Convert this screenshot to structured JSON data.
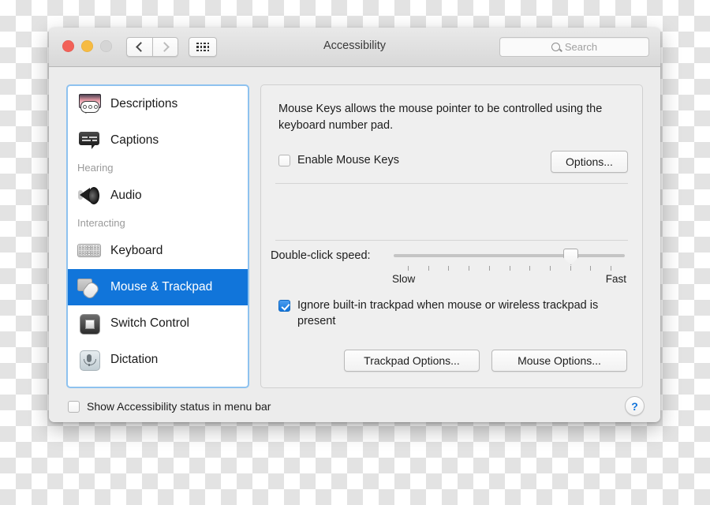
{
  "window": {
    "title": "Accessibility",
    "traffic_lights": {
      "close": "close-button",
      "minimize": "minimize-button",
      "zoom": "zoom-button"
    },
    "toolbar": {
      "back": "back-icon",
      "forward": "forward-icon",
      "show_all": "show-all-grid-icon"
    },
    "search": {
      "placeholder": "Search",
      "value": "",
      "icon": "search-icon"
    }
  },
  "sidebar": {
    "items": [
      {
        "label": "Descriptions",
        "icon": "descriptions-icon",
        "type": "item",
        "selected": false
      },
      {
        "label": "Captions",
        "icon": "captions-icon",
        "type": "item",
        "selected": false
      },
      {
        "label": "Hearing",
        "icon": "",
        "type": "group",
        "selected": false
      },
      {
        "label": "Audio",
        "icon": "audio-speaker-icon",
        "type": "item",
        "selected": false
      },
      {
        "label": "Interacting",
        "icon": "",
        "type": "group",
        "selected": false
      },
      {
        "label": "Keyboard",
        "icon": "keyboard-icon",
        "type": "item",
        "selected": false
      },
      {
        "label": "Mouse & Trackpad",
        "icon": "mouse-trackpad-icon",
        "type": "item",
        "selected": true
      },
      {
        "label": "Switch Control",
        "icon": "switch-control-icon",
        "type": "item",
        "selected": false
      },
      {
        "label": "Dictation",
        "icon": "dictation-mic-icon",
        "type": "item",
        "selected": false
      }
    ]
  },
  "pane": {
    "description": "Mouse Keys allows the mouse pointer to be controlled using the keyboard number pad.",
    "enable_mouse_keys": {
      "label": "Enable Mouse Keys",
      "checked": false
    },
    "options_button": "Options...",
    "double_click": {
      "label": "Double-click speed:",
      "slow_label": "Slow",
      "fast_label": "Fast",
      "tick_count": 11,
      "value_index": 9,
      "min": 1,
      "max": 11
    },
    "ignore_trackpad": {
      "label": "Ignore built-in trackpad when mouse or wireless trackpad is present",
      "checked": true
    },
    "trackpad_options_button": "Trackpad Options...",
    "mouse_options_button": "Mouse Options..."
  },
  "footer": {
    "show_status": {
      "label": "Show Accessibility status in menu bar",
      "checked": false
    },
    "help_button": "?"
  },
  "colors": {
    "selection_blue": "#1175da",
    "checkbox_blue": "#1174da",
    "focus_ring_blue": "#8ec2ef",
    "help_blue": "#1173da"
  }
}
